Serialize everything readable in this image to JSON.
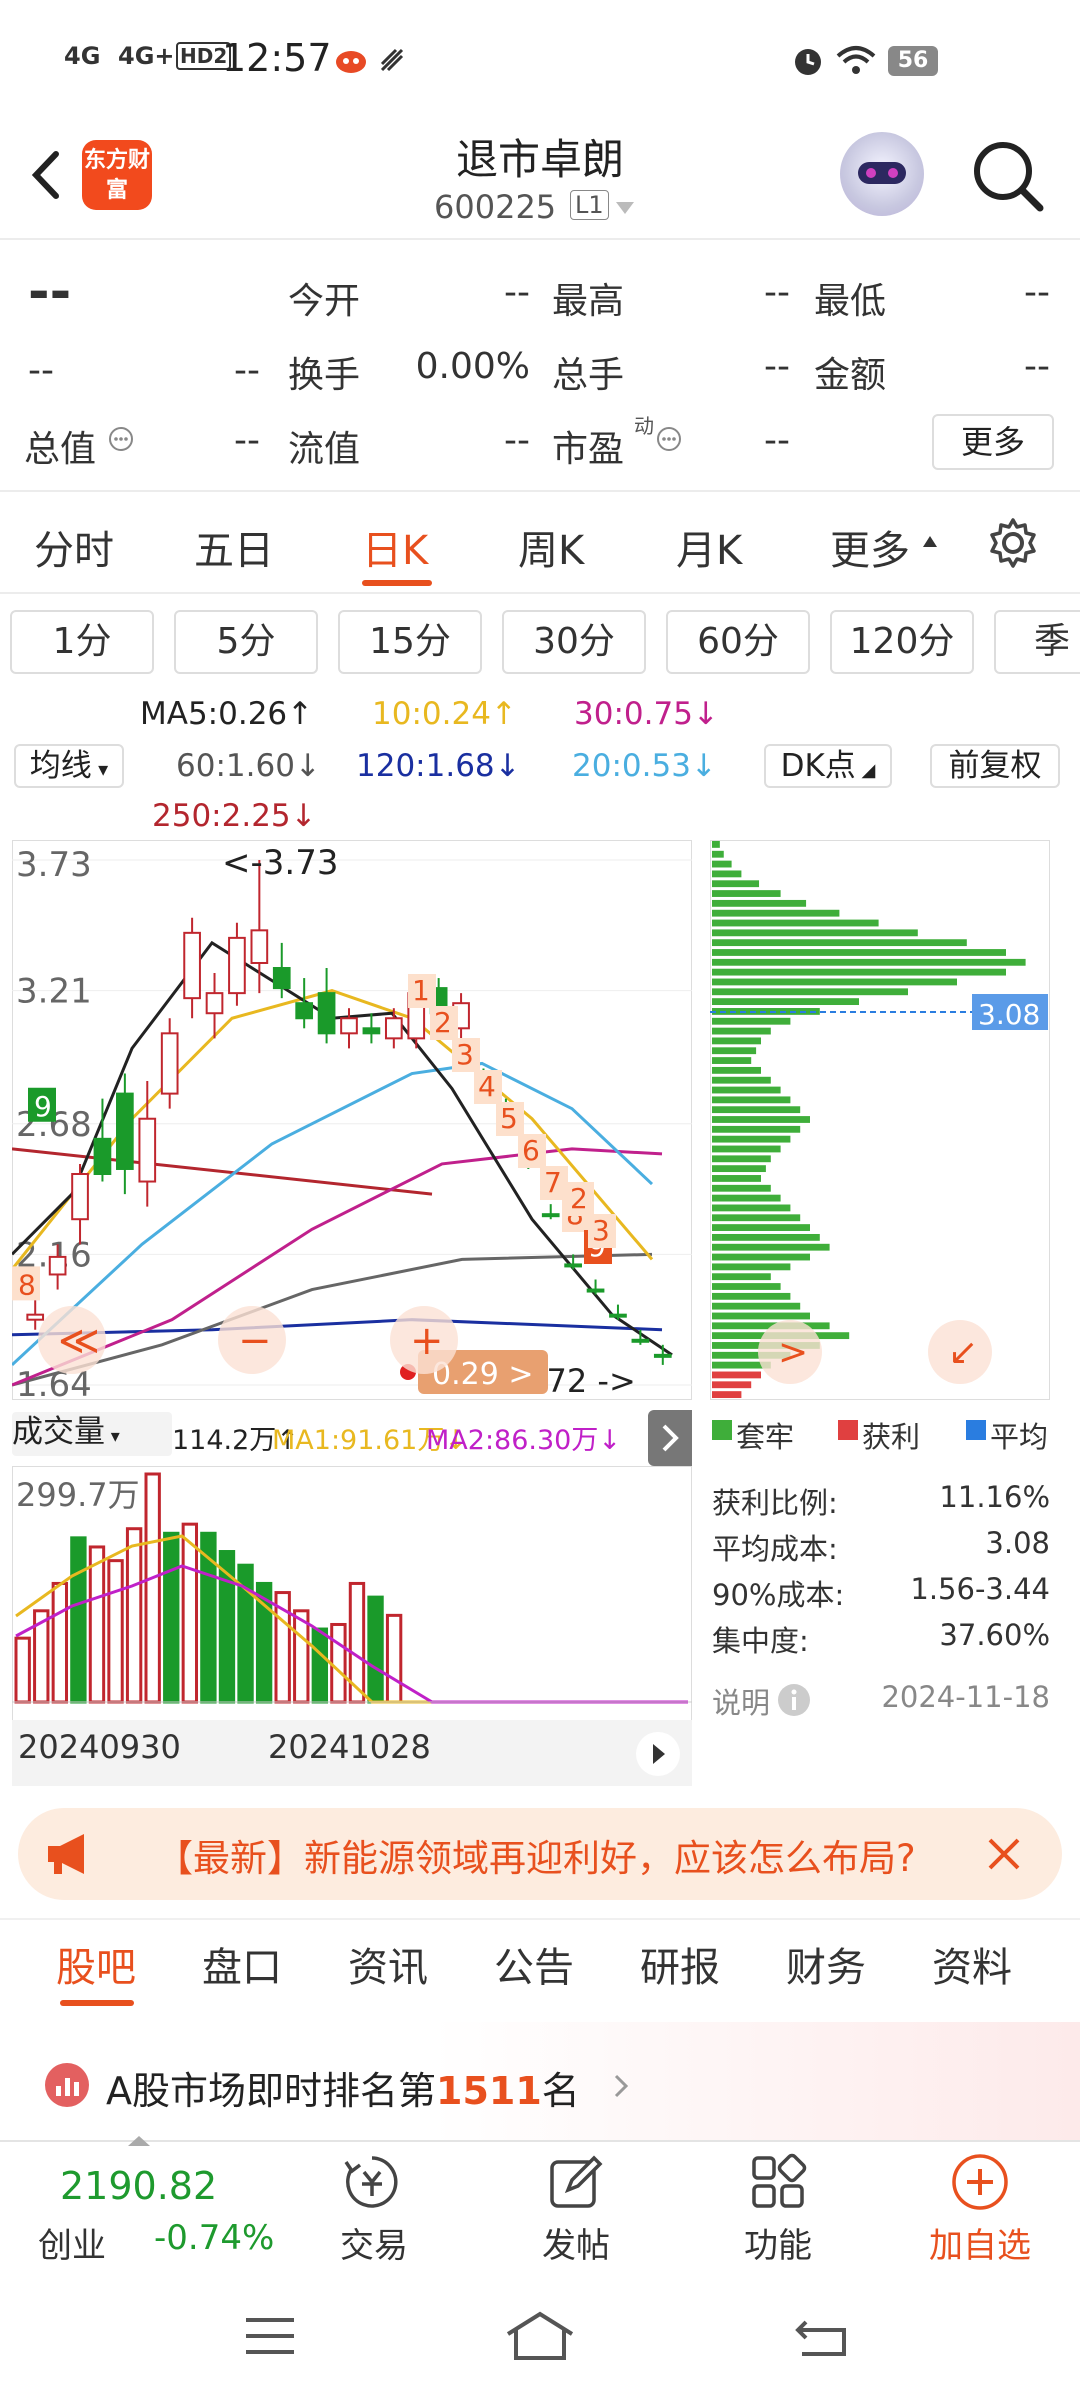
{
  "status": {
    "net1": "4G",
    "net2": "4G+",
    "hd": "HD2",
    "time": "12:57",
    "battery": "56"
  },
  "header": {
    "logo": "东方财富",
    "title": "退市卓朗",
    "code": "600225",
    "level": "L1"
  },
  "quote": {
    "price": "--",
    "change": "--",
    "change_pct": "--",
    "open_label": "今开",
    "open": "--",
    "high_label": "最高",
    "high": "--",
    "low_label": "最低",
    "low": "--",
    "turnover_label": "换手",
    "turnover": "0.00%",
    "vol_label": "总手",
    "vol": "--",
    "amount_label": "金额",
    "amount": "--",
    "mktcap_label": "总值",
    "mktcap": "--",
    "float_label": "流值",
    "float": "--",
    "pe_label": "市盈",
    "pe_sup": "动",
    "pe": "--",
    "more": "更多"
  },
  "tabs": [
    "分时",
    "五日",
    "日K",
    "周K",
    "月K",
    "更多"
  ],
  "periods": [
    "1分",
    "5分",
    "15分",
    "30分",
    "60分",
    "120分",
    "季"
  ],
  "ma": {
    "selector": "均线",
    "ma5": "MA5:0.26↑",
    "ma10": "10:0.24↑",
    "ma30": "30:0.75↓",
    "ma60": "60:1.60↓",
    "ma120": "120:1.68↓",
    "ma20": "20:0.53↓",
    "ma250": "250:2.25↓",
    "dk": "DK点",
    "adjust": "前复权",
    "colors": {
      "ma5": "#222222",
      "ma10": "#e8b820",
      "ma30": "#c0208c",
      "ma60": "#666666",
      "ma120": "#1a2fa0",
      "ma20": "#4aaee0",
      "ma250": "#b3262e"
    }
  },
  "chart_data": {
    "type": "candlestick",
    "y_ticks": [
      "3.73",
      "3.21",
      "2.68",
      "2.16",
      "1.64"
    ],
    "ylim": [
      1.64,
      3.73
    ],
    "max_marker": "<-3.73",
    "min_marker": "1.72 ->",
    "cursor_label": "0.29 >",
    "td_labels_up": [
      "8",
      "9"
    ],
    "td_labels_down": [
      "1",
      "2",
      "3",
      "4",
      "5",
      "6",
      "7",
      "8",
      "9",
      "2",
      "3"
    ],
    "candles": [
      {
        "o": 1.92,
        "h": 2.02,
        "l": 1.86,
        "c": 1.9,
        "up": false
      },
      {
        "o": 2.08,
        "h": 2.2,
        "l": 2.02,
        "c": 2.15,
        "up": false
      },
      {
        "o": 2.3,
        "h": 2.52,
        "l": 2.2,
        "c": 2.48,
        "up": false
      },
      {
        "o": 2.62,
        "h": 2.78,
        "l": 2.45,
        "c": 2.48,
        "up": true
      },
      {
        "o": 2.5,
        "h": 2.88,
        "l": 2.4,
        "c": 2.8,
        "up": true
      },
      {
        "o": 2.7,
        "h": 2.85,
        "l": 2.35,
        "c": 2.45,
        "up": false
      },
      {
        "o": 2.8,
        "h": 3.1,
        "l": 2.74,
        "c": 3.04,
        "up": false
      },
      {
        "o": 3.18,
        "h": 3.5,
        "l": 3.1,
        "c": 3.44,
        "up": false
      },
      {
        "o": 3.12,
        "h": 3.28,
        "l": 3.02,
        "c": 3.2,
        "up": false
      },
      {
        "o": 3.2,
        "h": 3.48,
        "l": 3.15,
        "c": 3.42,
        "up": false
      },
      {
        "o": 3.32,
        "h": 3.73,
        "l": 3.2,
        "c": 3.45,
        "up": false
      },
      {
        "o": 3.3,
        "h": 3.4,
        "l": 3.18,
        "c": 3.22,
        "up": true
      },
      {
        "o": 3.16,
        "h": 3.26,
        "l": 3.06,
        "c": 3.1,
        "up": true
      },
      {
        "o": 3.2,
        "h": 3.3,
        "l": 3.0,
        "c": 3.04,
        "up": true
      },
      {
        "o": 3.04,
        "h": 3.14,
        "l": 2.98,
        "c": 3.1,
        "up": false
      },
      {
        "o": 3.06,
        "h": 3.12,
        "l": 3.0,
        "c": 3.04,
        "up": true
      },
      {
        "o": 3.02,
        "h": 3.14,
        "l": 2.98,
        "c": 3.1,
        "up": false
      },
      {
        "o": 3.02,
        "h": 3.24,
        "l": 2.98,
        "c": 3.2,
        "up": false
      },
      {
        "o": 3.22,
        "h": 3.26,
        "l": 3.08,
        "c": 3.12,
        "up": true
      },
      {
        "o": 3.06,
        "h": 3.2,
        "l": 3.02,
        "c": 3.16,
        "up": false
      },
      {
        "o": 2.86,
        "h": 2.9,
        "l": 2.84,
        "c": 2.86,
        "up": true
      },
      {
        "o": 2.76,
        "h": 2.78,
        "l": 2.74,
        "c": 2.76,
        "up": true
      },
      {
        "o": 2.52,
        "h": 2.56,
        "l": 2.5,
        "c": 2.52,
        "up": true
      },
      {
        "o": 2.32,
        "h": 2.36,
        "l": 2.3,
        "c": 2.32,
        "up": true
      },
      {
        "o": 2.12,
        "h": 2.16,
        "l": 2.1,
        "c": 2.12,
        "up": true
      },
      {
        "o": 2.02,
        "h": 2.06,
        "l": 2.0,
        "c": 2.02,
        "up": true
      },
      {
        "o": 1.92,
        "h": 1.96,
        "l": 1.9,
        "c": 1.92,
        "up": true
      },
      {
        "o": 1.82,
        "h": 1.86,
        "l": 1.8,
        "c": 1.82,
        "up": true
      },
      {
        "o": 1.76,
        "h": 1.8,
        "l": 1.72,
        "c": 1.76,
        "up": true
      }
    ]
  },
  "distribution": {
    "price_label": "3.08",
    "legend": [
      "套牢",
      "获利",
      "平均"
    ],
    "legend_colors": [
      "#3fae3a",
      "#e04040",
      "#2a7de0"
    ],
    "profit_ratio_label": "获利比例:",
    "profit_ratio": "11.16%",
    "avg_cost_label": "平均成本:",
    "avg_cost": "3.08",
    "cost90_label": "90%成本:",
    "cost90": "1.56-3.44",
    "concentration_label": "集中度:",
    "concentration": "37.60%",
    "note_label": "说明",
    "date": "2024-11-18"
  },
  "volume": {
    "selector": "成交量",
    "vol": "114.2万↑",
    "ma1": "MA1:91.61万↓",
    "ma2": "MA2:86.30万↓",
    "top_label": "299.7万",
    "dates": [
      "20240930",
      "20241028"
    ],
    "bars": [
      {
        "v": 0.28,
        "up": true
      },
      {
        "v": 0.4,
        "up": true
      },
      {
        "v": 0.52,
        "up": true
      },
      {
        "v": 0.72,
        "up": false
      },
      {
        "v": 0.68,
        "up": true
      },
      {
        "v": 0.62,
        "up": true
      },
      {
        "v": 0.76,
        "up": true
      },
      {
        "v": 1.0,
        "up": true
      },
      {
        "v": 0.74,
        "up": false
      },
      {
        "v": 0.78,
        "up": true
      },
      {
        "v": 0.74,
        "up": false
      },
      {
        "v": 0.66,
        "up": false
      },
      {
        "v": 0.6,
        "up": false
      },
      {
        "v": 0.52,
        "up": false
      },
      {
        "v": 0.48,
        "up": true
      },
      {
        "v": 0.4,
        "up": true
      },
      {
        "v": 0.32,
        "up": false
      },
      {
        "v": 0.34,
        "up": true
      },
      {
        "v": 0.52,
        "up": true
      },
      {
        "v": 0.46,
        "up": false
      },
      {
        "v": 0.38,
        "up": true
      }
    ]
  },
  "news": {
    "text": "【最新】新能源领域再迎利好，应该怎么布局?"
  },
  "bottom_tabs": [
    "股吧",
    "盘口",
    "资讯",
    "公告",
    "研报",
    "财务",
    "资料"
  ],
  "ranking": {
    "prefix": "A股市场即时排名第",
    "rank": "1511",
    "suffix": "名"
  },
  "index": {
    "value": "2190.82",
    "name": "创业",
    "change": "-0.74%"
  },
  "nav": {
    "trade": "交易",
    "post": "发帖",
    "func": "功能",
    "add": "加自选"
  }
}
